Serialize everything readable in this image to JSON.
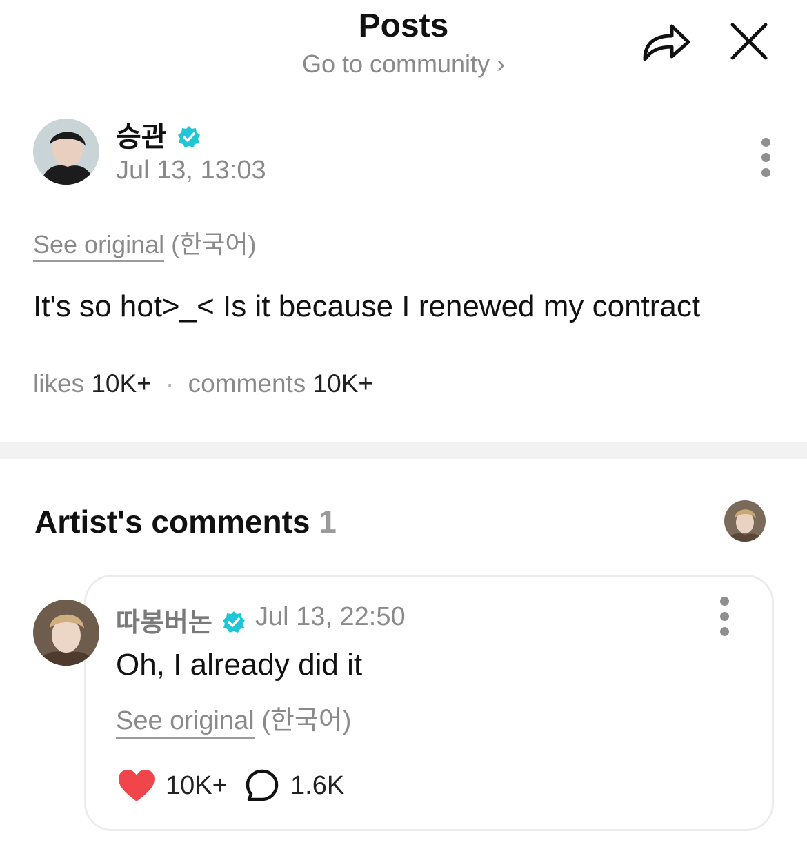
{
  "header": {
    "title": "Posts",
    "subtitle": "Go to community",
    "subtitle_chevron": "›",
    "share_icon": "share-arrow-icon",
    "close_icon": "close-icon"
  },
  "post": {
    "author": "승관",
    "verified_icon": "verified-badge-icon",
    "timestamp": "Jul 13, 13:03",
    "see_original": "See original",
    "original_lang": "(한국어)",
    "text": "It's so hot>_< Is it because I renewed my contract",
    "likes_label": "likes",
    "likes_count": "10K+",
    "separator": "·",
    "comments_label": "comments",
    "comments_count": "10K+"
  },
  "artist_comments": {
    "title": "Artist's comments",
    "count": "1"
  },
  "comment": {
    "author": "따봉버논",
    "timestamp": "Jul 13, 22:50",
    "text": "Oh, I already did it",
    "see_original": "See original",
    "original_lang": "(한국어)",
    "likes": "10K+",
    "replies": "1.6K",
    "heart_color": "#f0454a",
    "verified_color": "#1fc6d4"
  }
}
